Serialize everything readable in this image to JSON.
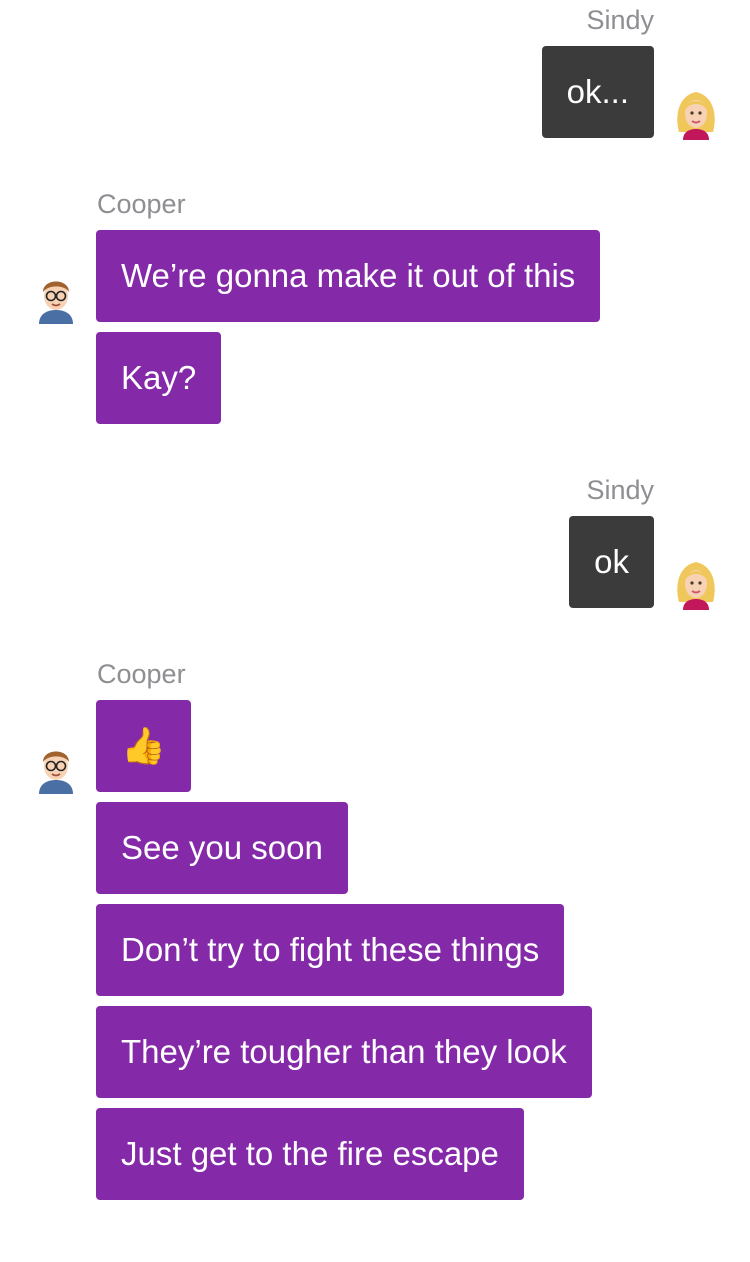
{
  "messages": [
    {
      "sender": "Sindy",
      "texts": [
        "ok..."
      ]
    },
    {
      "sender": "Cooper",
      "texts": [
        "We’re gonna make it out of this",
        "Kay?"
      ]
    },
    {
      "sender": "Sindy",
      "texts": [
        "ok"
      ]
    },
    {
      "sender": "Cooper",
      "texts": [
        "👍",
        "See you soon",
        "Don’t try to fight these things",
        "They’re tougher than they look",
        "Just get to the fire escape"
      ]
    }
  ],
  "colors": {
    "sindy_bubble": "#3b3b3b",
    "cooper_bubble": "#8429a8",
    "sender_name": "#8e8e93",
    "background": "#ffffff"
  },
  "icons": {
    "sindy_avatar": "blonde-woman-avatar-icon",
    "cooper_avatar": "boy-with-glasses-avatar-icon",
    "thumbs_up": "thumbs-up-emoji"
  }
}
